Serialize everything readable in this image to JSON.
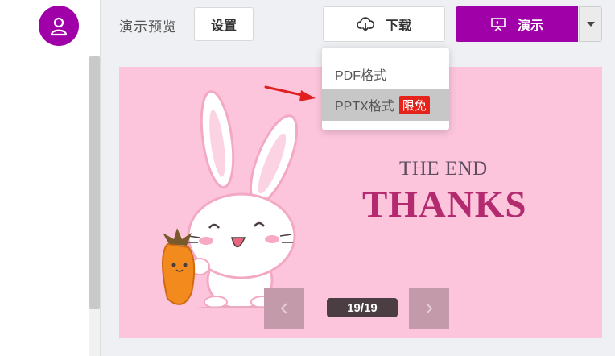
{
  "header": {
    "title": "演示预览",
    "settings_label": "设置",
    "download_label": "下载",
    "present_label": "演示"
  },
  "download_menu": {
    "items": [
      {
        "label": "PDF格式"
      },
      {
        "label": "PPTX格式",
        "badge": "限免"
      }
    ]
  },
  "slide": {
    "subtitle": "THE END",
    "title": "THANKS",
    "page_indicator": "19/19"
  },
  "colors": {
    "brand": "#a000a8",
    "slide_background": "#fdc5dc",
    "thanks_text": "#b32a6e",
    "badge": "#e5231b"
  },
  "icons": {
    "avatar": "user-icon",
    "download": "cloud-download-icon",
    "present": "projector-icon",
    "present_menu": "caret-down-icon",
    "prev": "chevron-left-icon",
    "next": "chevron-right-icon",
    "annotation": "red-arrow-icon"
  }
}
